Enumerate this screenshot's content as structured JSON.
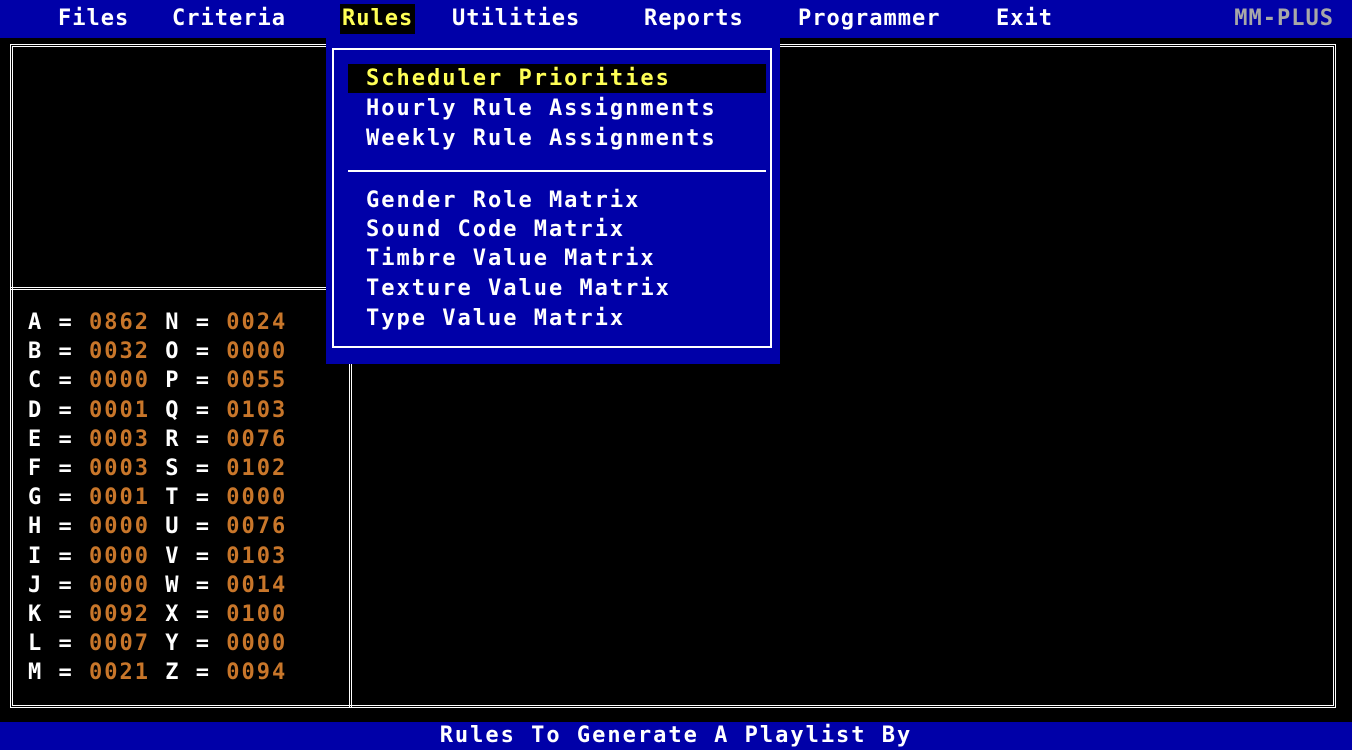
{
  "menubar": {
    "items": [
      "Files",
      "Criteria",
      "Rules",
      "Utilities",
      "Reports",
      "Programmer",
      "Exit"
    ],
    "active": "Rules",
    "brand": "MM-PLUS"
  },
  "rules_menu": {
    "group1": [
      "Scheduler Priorities",
      "Hourly Rule Assignments",
      "Weekly Rule Assignments"
    ],
    "group2": [
      "Gender Role Matrix",
      "Sound Code Matrix",
      "Timbre Value Matrix",
      "Texture Value Matrix",
      "Type Value Matrix"
    ],
    "selected": "Scheduler Priorities"
  },
  "counts": [
    {
      "l1": "A",
      "v1": "0862",
      "l2": "N",
      "v2": "0024"
    },
    {
      "l1": "B",
      "v1": "0032",
      "l2": "O",
      "v2": "0000"
    },
    {
      "l1": "C",
      "v1": "0000",
      "l2": "P",
      "v2": "0055"
    },
    {
      "l1": "D",
      "v1": "0001",
      "l2": "Q",
      "v2": "0103"
    },
    {
      "l1": "E",
      "v1": "0003",
      "l2": "R",
      "v2": "0076"
    },
    {
      "l1": "F",
      "v1": "0003",
      "l2": "S",
      "v2": "0102"
    },
    {
      "l1": "G",
      "v1": "0001",
      "l2": "T",
      "v2": "0000"
    },
    {
      "l1": "H",
      "v1": "0000",
      "l2": "U",
      "v2": "0076"
    },
    {
      "l1": "I",
      "v1": "0000",
      "l2": "V",
      "v2": "0103"
    },
    {
      "l1": "J",
      "v1": "0000",
      "l2": "W",
      "v2": "0014"
    },
    {
      "l1": "K",
      "v1": "0092",
      "l2": "X",
      "v2": "0100"
    },
    {
      "l1": "L",
      "v1": "0007",
      "l2": "Y",
      "v2": "0000"
    },
    {
      "l1": "M",
      "v1": "0021",
      "l2": "Z",
      "v2": "0094"
    }
  ],
  "status": "Rules To Generate A Playlist By",
  "colors": {
    "menu_bg": "#0000a8",
    "highlight_text": "#ffff55",
    "count_value": "#c8762a",
    "brand": "#a8a8a8"
  }
}
